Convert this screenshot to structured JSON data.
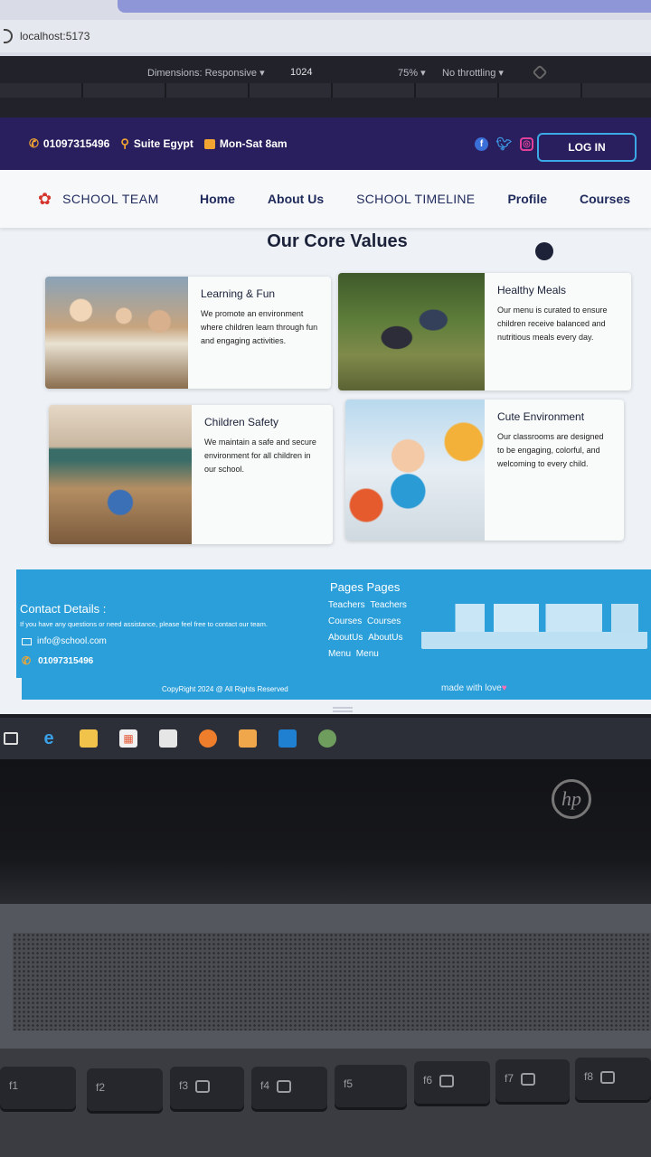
{
  "browser": {
    "url": "localhost:5173"
  },
  "devtools": {
    "dimensions": "Dimensions: Responsive ▾",
    "width": "1024",
    "zoom": "75% ▾",
    "throttling": "No throttling ▾"
  },
  "topbar": {
    "phone": "01097315496",
    "location": "Suite Egypt",
    "hours": "Mon-Sat 8am",
    "login": "LOG IN"
  },
  "navbar": {
    "brand": "SCHOOL TEAM",
    "links": [
      "Home",
      "About Us",
      "SCHOOL TIMELINE",
      "Profile",
      "Courses"
    ]
  },
  "values": {
    "title": "Our Core Values",
    "cards": [
      {
        "title": "Learning & Fun",
        "text": "We promote an environment where children learn through fun and engaging activities."
      },
      {
        "title": "Healthy Meals",
        "text": "Our menu is curated to ensure children receive balanced and nutritious meals every day."
      },
      {
        "title": "Children Safety",
        "text": "We maintain a safe and secure environment for all children in our school."
      },
      {
        "title": "Cute Environment",
        "text": "Our classrooms are designed to be engaging, colorful, and welcoming to every child."
      }
    ]
  },
  "footer": {
    "contact_title": "Contact Details :",
    "contact_note": "If you have any questions or need assistance, please feel free to contact our team.",
    "email": "info@school.com",
    "phone": "01097315496",
    "pages_title": "Pages Pages",
    "pages": [
      [
        "Teachers",
        "Teachers"
      ],
      [
        "Courses",
        "Courses"
      ],
      [
        "AboutUs",
        "AboutUs"
      ],
      [
        "Menu",
        "Menu"
      ]
    ],
    "copyright": "CopyRight 2024 @ All Rights Reserved",
    "made_with": "made with love"
  },
  "keyboard": {
    "keys": [
      "f1",
      "f2",
      "f3",
      "f4",
      "f5",
      "f6",
      "f7",
      "f8"
    ]
  },
  "colors": {
    "topbar": "#2a1f5e",
    "footer": "#2b9fd9",
    "accent": "#f2a531"
  }
}
